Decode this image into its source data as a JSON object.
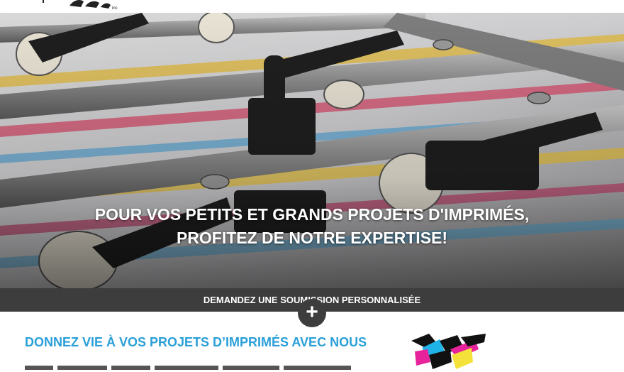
{
  "hero": {
    "headline_line1": "POUR VOS PETITS ET GRANDS PROJETS D'IMPRIMÉS,",
    "headline_line2": "PROFITEZ DE NOTRE EXPERTISE!"
  },
  "cta": {
    "label": "DEMANDEZ UNE SOUMISSION PERSONNALISÉE",
    "expand_symbol": "+"
  },
  "section": {
    "title": "DONNEZ VIE À VOS PROJETS D’IMPRIMÉS AVEC NOUS"
  },
  "icons": {
    "expand": "plus-icon"
  },
  "colors": {
    "accent": "#2a9fd8",
    "cta_bar": "#3d3d3d",
    "hero_overlay": "#3a3a3a"
  }
}
